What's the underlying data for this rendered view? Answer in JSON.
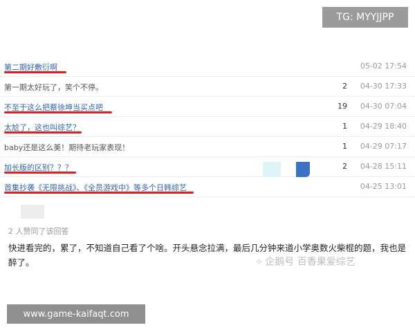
{
  "badge": {
    "text": "TG: MYYJJPP"
  },
  "rows": [
    {
      "title": "第二期好敷衍啊",
      "count": "",
      "date": "05-02 17:54",
      "underlined": true
    },
    {
      "title": "第一期太好玩了，笑个不停。",
      "count": "2",
      "date": "04-30 17:33",
      "underlined": false
    },
    {
      "title": "不至于这么把蔡徐坤当买点吧",
      "count": "19",
      "date": "04-30 07:04",
      "underlined": true
    },
    {
      "title": "太尬了，这也叫综艺？",
      "count": "1",
      "date": "04-29 18:40",
      "underlined": true
    },
    {
      "title": "baby还是这么美！期待老玩家表现！",
      "count": "1",
      "date": "04-29 07:17",
      "underlined": false
    },
    {
      "title": "加长版的区别？？？",
      "count": "2",
      "date": "04-28 15:11",
      "underlined": true
    },
    {
      "title": "首集抄袭《无限挑战》、《全员游戏中》等多个日韩综艺",
      "count": "",
      "date": "04-25 13:01",
      "underlined": true
    }
  ],
  "reply": {
    "meta": "2 人赞同了该回答",
    "text": "快进看完的，累了，不知道自己看了个啥。开头悬念拉满，最后几分钟来道小学奥数火柴棍的题，我也是醉了。"
  },
  "watermark": {
    "text": "企鹅号 百香果爱综艺",
    "icon": "penguin-icon"
  },
  "footer": {
    "text": "www.game-kaifaqt.com"
  },
  "colors": {
    "link": "#2d64b3",
    "underline": "#e21d1d",
    "date": "#999999"
  }
}
